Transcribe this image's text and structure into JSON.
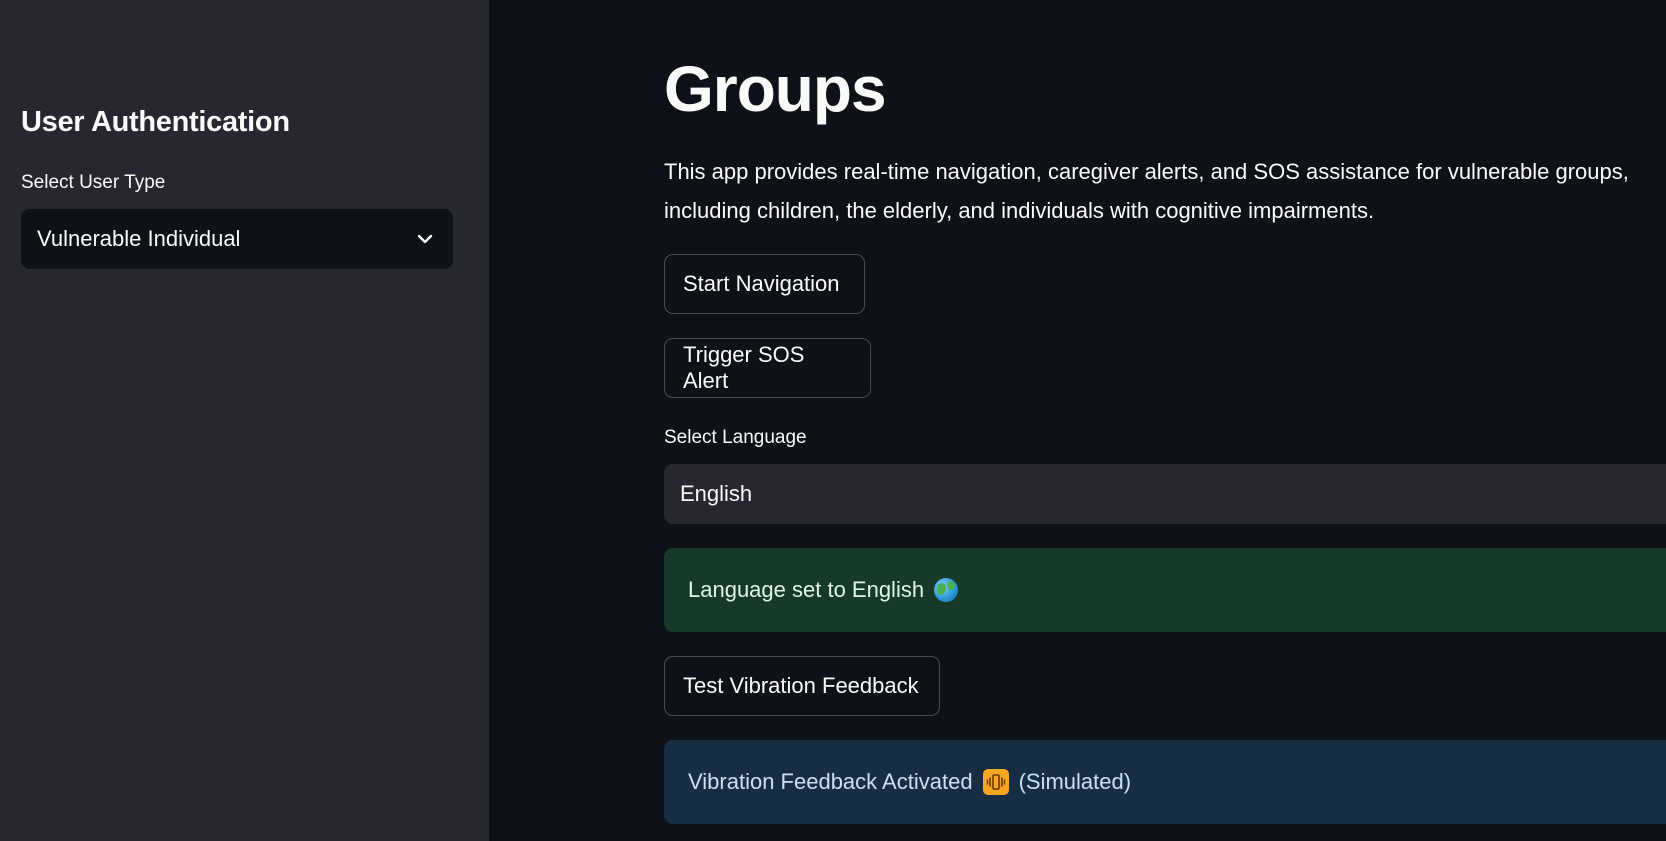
{
  "sidebar": {
    "title": "User Authentication",
    "user_type_label": "Select User Type",
    "user_type_value": "Vulnerable Individual"
  },
  "main": {
    "title": "Groups",
    "intro_line1": "This app provides real-time navigation, caregiver alerts, and SOS assistance for vulnerable groups,",
    "intro_line2": "including children, the elderly, and individuals with cognitive impairments.",
    "start_navigation_label": "Start Navigation",
    "trigger_sos_label": "Trigger SOS Alert",
    "language_label": "Select Language",
    "language_value": "English",
    "language_alert_text": "Language set to English",
    "test_vibration_label": "Test Vibration Feedback",
    "vibration_alert_prefix": "Vibration Feedback Activated",
    "vibration_alert_suffix": "(Simulated)"
  },
  "icons": {
    "user_type_dropdown": "chevron-down-icon",
    "language_alert": "globe-icon",
    "vibration_alert": "vibration-mode-icon"
  },
  "colors": {
    "background": "#0e1117",
    "sidebar": "#262730",
    "success_bg": "#173928",
    "info_bg": "#172d43",
    "vibration_icon": "#f5a623"
  }
}
